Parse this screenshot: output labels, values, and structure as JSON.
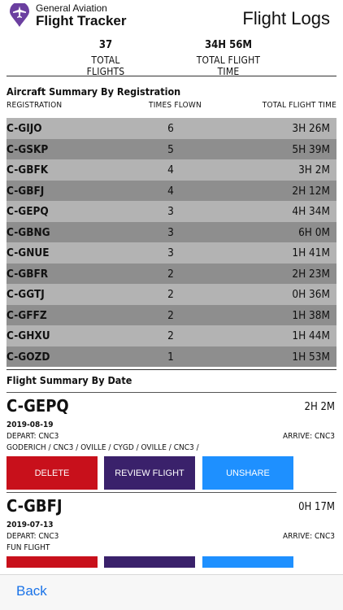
{
  "header": {
    "brand_sub": "General Aviation",
    "brand_main": "Flight Tracker",
    "page_title": "Flight Logs",
    "logo_color": "#6b3fa0"
  },
  "stats": {
    "total_flights": {
      "value": "37",
      "label": "TOTAL FLIGHTS"
    },
    "total_time": {
      "value": "34H 56M",
      "label": "TOTAL FLIGHT TIME"
    }
  },
  "aircraft_summary": {
    "title": "Aircraft Summary By Registration",
    "columns": [
      "REGISTRATION",
      "TIMES FLOWN",
      "TOTAL FLIGHT TIME"
    ],
    "rows": [
      {
        "reg": "C-GIJO",
        "count": "6",
        "time": "3H 26M"
      },
      {
        "reg": "C-GSKP",
        "count": "5",
        "time": "5H 39M"
      },
      {
        "reg": "C-GBFK",
        "count": "4",
        "time": "3H 2M"
      },
      {
        "reg": "C-GBFJ",
        "count": "4",
        "time": "2H 12M"
      },
      {
        "reg": "C-GEPQ",
        "count": "3",
        "time": "4H 34M"
      },
      {
        "reg": "C-GBNG",
        "count": "3",
        "time": "6H 0M"
      },
      {
        "reg": "C-GNUE",
        "count": "3",
        "time": "1H 41M"
      },
      {
        "reg": "C-GBFR",
        "count": "2",
        "time": "2H 23M"
      },
      {
        "reg": "C-GGTJ",
        "count": "2",
        "time": "0H 36M"
      },
      {
        "reg": "C-GFFZ",
        "count": "2",
        "time": "1H 38M"
      },
      {
        "reg": "C-GHXU",
        "count": "2",
        "time": "1H 44M"
      },
      {
        "reg": "C-GOZD",
        "count": "1",
        "time": "1H 53M"
      }
    ]
  },
  "flight_summary": {
    "title": "Flight Summary By Date",
    "flights": [
      {
        "reg": "C-GEPQ",
        "duration": "2H 2M",
        "date": "2019-08-19",
        "depart": "DEPART: CNC3",
        "arrive": "ARRIVE: CNC3",
        "notes": "GODERICH / CNC3 / OVILLE / CYGD / OVILLE / CNC3 /"
      },
      {
        "reg": "C-GBFJ",
        "duration": "0H 17M",
        "date": "2019-07-13",
        "depart": "DEPART: CNC3",
        "arrive": "ARRIVE: CNC3",
        "notes": "FUN FLIGHT"
      }
    ],
    "buttons": {
      "delete": "DELETE",
      "review": "REVIEW FLIGHT",
      "unshare": "UNSHARE"
    }
  },
  "footer": {
    "back": "Back"
  }
}
